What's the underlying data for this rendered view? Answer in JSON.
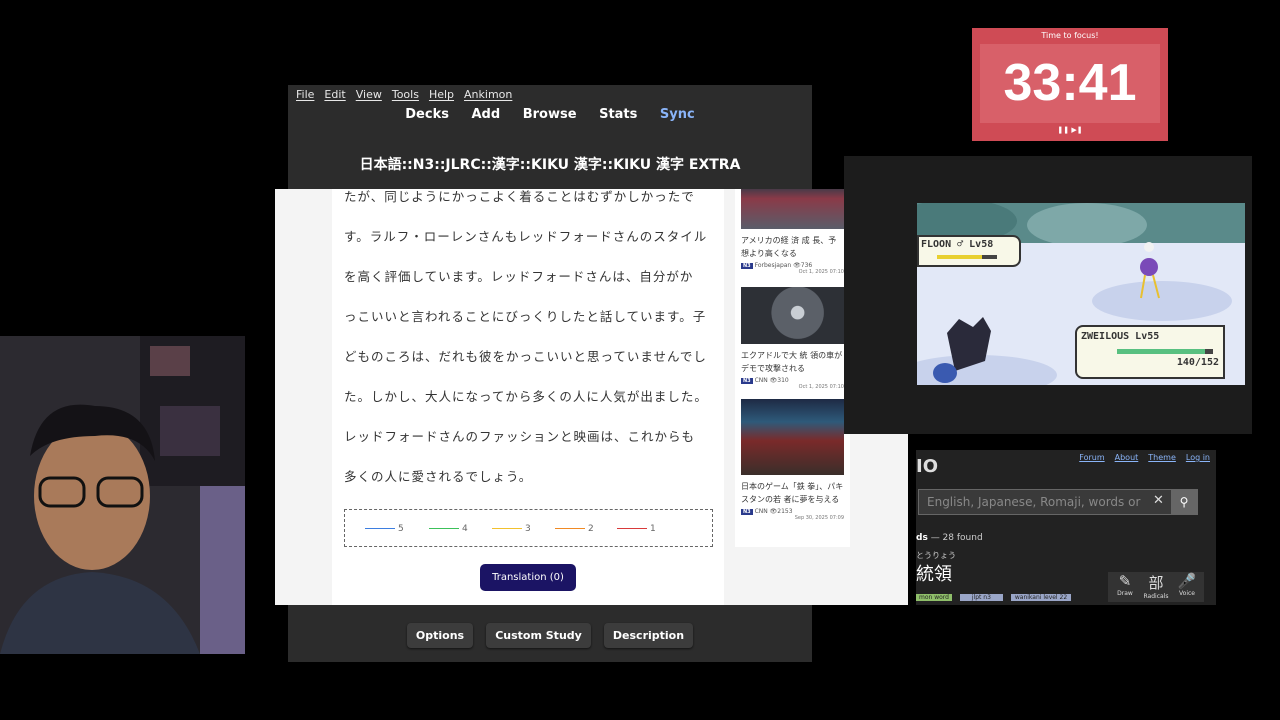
{
  "anki": {
    "menu": [
      "File",
      "Edit",
      "View",
      "Tools",
      "Help",
      "Ankimon"
    ],
    "toolbar": {
      "decks": "Decks",
      "add": "Add",
      "browse": "Browse",
      "stats": "Stats",
      "sync": "Sync"
    },
    "deck_title": "日本語::N3::JLRC::漢字::KIKU 漢字::KIKU 漢字 EXTRA",
    "bottom": {
      "options": "Options",
      "custom_study": "Custom Study",
      "description": "Description"
    }
  },
  "reader": {
    "lines": [
      "たが、同じようにかっこよく着ることはむずかしかったで",
      "す。ラルフ・ローレンさんもレッドフォードさんのスタイル",
      "を高く評価しています。レッドフォードさんは、自分がか",
      "っこいいと言われることにびっくりしたと話しています。子",
      "どものころは、だれも彼をかっこいいと思っていませんでし",
      "た。しかし、大人になってから多くの人に人気が出ました。",
      "レッドフォードさんのファッションと映画は、これからも",
      "多くの人に愛されるでしょう。"
    ],
    "legend": [
      {
        "label": "5",
        "color": "#3d7ee0"
      },
      {
        "label": "4",
        "color": "#3cc15a"
      },
      {
        "label": "3",
        "color": "#f2c12e"
      },
      {
        "label": "2",
        "color": "#f08a24"
      },
      {
        "label": "1",
        "color": "#d83a3a"
      }
    ],
    "translation_button": "Translation (0)",
    "news": [
      {
        "title": "アメリカの経 済 成 長、予想より高くなる",
        "level": "N3",
        "source": "Forbesjapan",
        "views": "736",
        "date": "Oct 1, 2025 07:10"
      },
      {
        "title": "エクアドルで大 統 領の車がデモで攻撃される",
        "level": "N3",
        "source": "CNN",
        "views": "310",
        "date": "Oct 1, 2025 07:10"
      },
      {
        "title": "日本のゲーム「鉄 拳」、パキスタンの若 者に夢を与える",
        "level": "N3",
        "source": "CNN",
        "views": "2153",
        "date": "Sep 30, 2025 07:09"
      }
    ]
  },
  "timer": {
    "label": "Time to focus!",
    "time": "33:41",
    "controls": "❚❚ ▶❚"
  },
  "game": {
    "enemy_name": "FLOON ♂ Lv58",
    "player_name": "ZWEILOUS Lv55",
    "player_hp": "140/152",
    "enemy_hp_fraction": 0.75,
    "player_hp_fraction": 0.92
  },
  "jisho": {
    "logo": "IO",
    "links": [
      "Forum",
      "About",
      "Theme",
      "Log in"
    ],
    "search_placeholder": "English, Japanese, Romaji, words or t",
    "found_prefix": "ds",
    "found_text": "— 28 found",
    "reading": "とうりょう",
    "word": "統領",
    "tags": [
      "mon word",
      "jlpt n3",
      "wanikani level 22"
    ],
    "tools": [
      {
        "glyph": "✎",
        "label": "Draw"
      },
      {
        "glyph": "部",
        "label": "Radicals"
      },
      {
        "glyph": "🎤",
        "label": "Voice"
      }
    ]
  }
}
